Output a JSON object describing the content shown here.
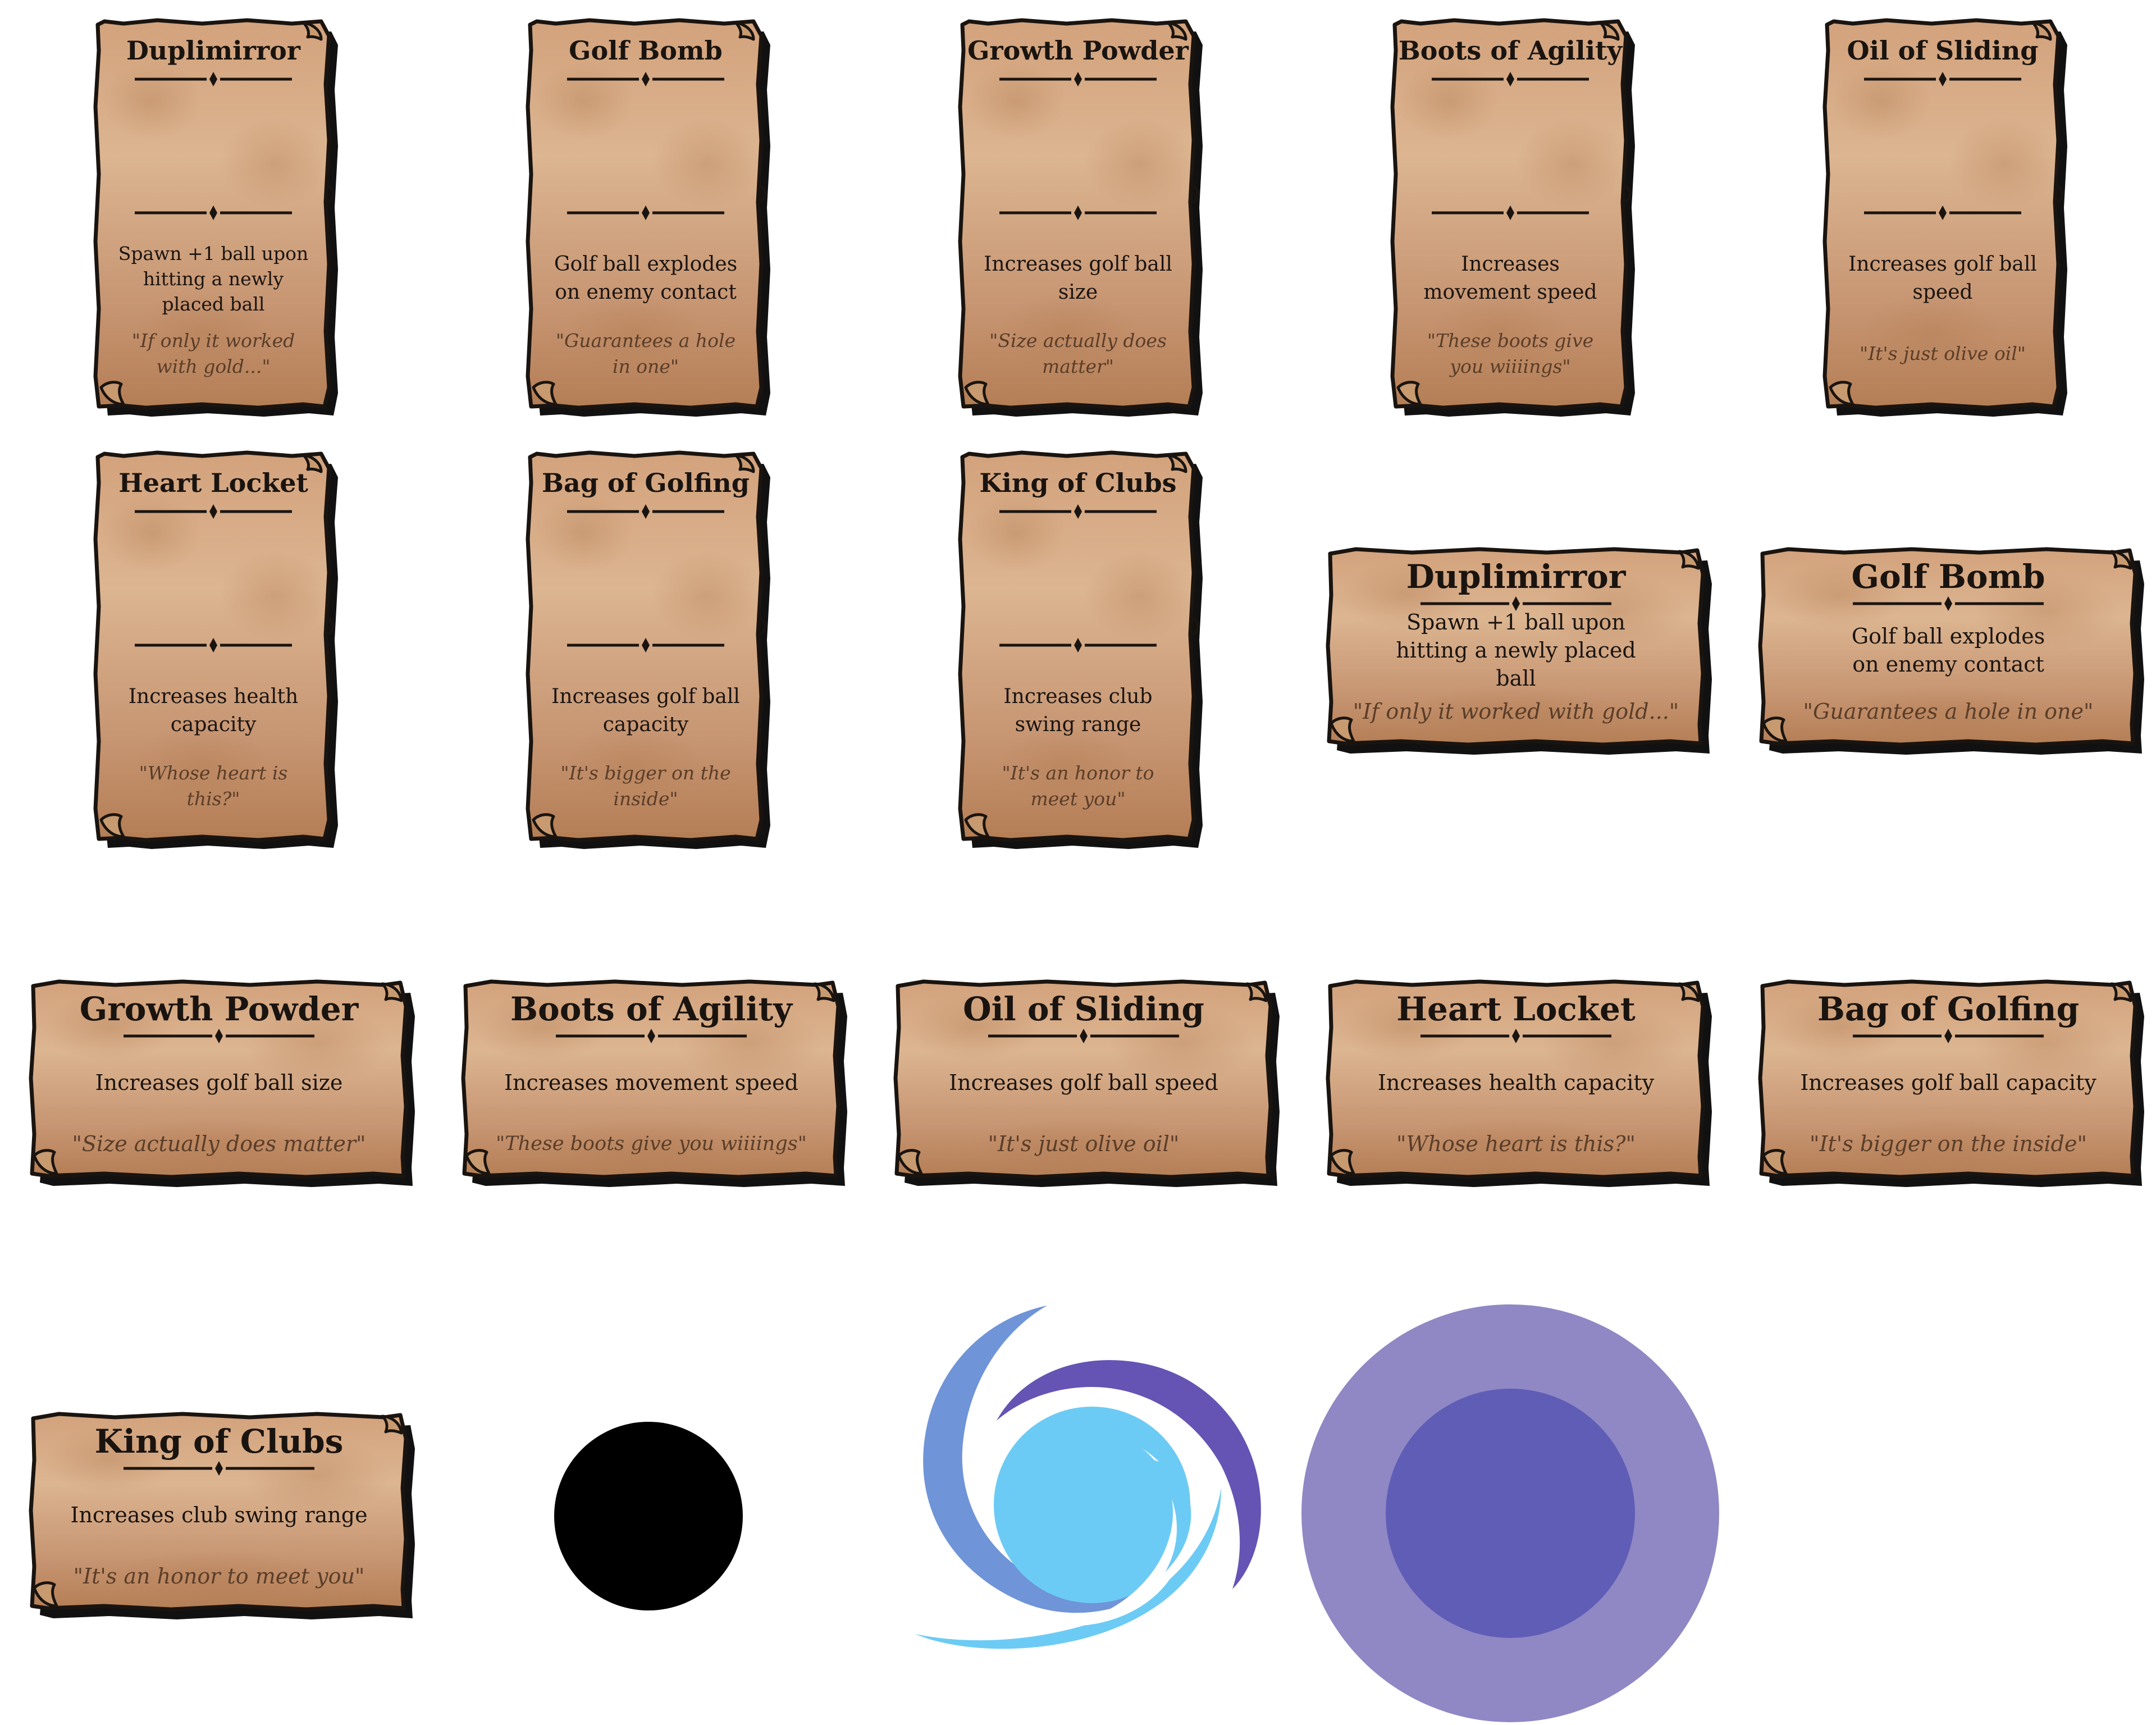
{
  "colors": {
    "parchment_light": "#dcb48f",
    "parchment_dark": "#b47e55",
    "outline": "#1a1410",
    "text": "#1a1410",
    "quote_text": "#5a3d28",
    "black_hole": "#000000",
    "swirl_light": "#6ccbf4",
    "swirl_mid": "#6f94d8",
    "swirl_dark": "#6554b4",
    "portal_outer": "#9088c4",
    "portal_inner": "#5f5db6"
  },
  "cards_portrait": [
    {
      "title": "Duplimirror",
      "desc": "Spawn +1 ball upon hitting a newly placed ball",
      "quote": "\"If only it worked with gold...\""
    },
    {
      "title": "Golf Bomb",
      "desc": "Golf ball explodes on enemy contact",
      "quote": "\"Guarantees a hole in one\""
    },
    {
      "title": "Growth Powder",
      "desc": "Increases golf ball size",
      "quote": "\"Size actually does matter\""
    },
    {
      "title": "Boots of Agility",
      "desc": "Increases movement speed",
      "quote": "\"These boots give you wiiiings\""
    },
    {
      "title": "Oil of Sliding",
      "desc": "Increases golf ball speed",
      "quote": "\"It's just olive oil\""
    },
    {
      "title": "Heart Locket",
      "desc": "Increases health capacity",
      "quote": "\"Whose heart is this?\""
    },
    {
      "title": "Bag of Golfing",
      "desc": "Increases golf ball capacity",
      "quote": "\"It's bigger on the inside\""
    },
    {
      "title": "King of Clubs",
      "desc": "Increases club swing range",
      "quote": "\"It's an honor to meet you\""
    }
  ],
  "cards_landscape": [
    {
      "title": "Duplimirror",
      "desc": "Spawn +1 ball upon hitting a newly placed ball",
      "quote": "\"If only it worked with gold...\""
    },
    {
      "title": "Golf Bomb",
      "desc": "Golf ball explodes on enemy contact",
      "quote": "\"Guarantees a hole in one\""
    },
    {
      "title": "Growth Powder",
      "desc": "Increases golf ball size",
      "quote": "\"Size actually does matter\""
    },
    {
      "title": "Boots of Agility",
      "desc": "Increases movement speed",
      "quote": "\"These boots give you wiiiings\""
    },
    {
      "title": "Oil of Sliding",
      "desc": "Increases golf ball speed",
      "quote": "\"It's just olive oil\""
    },
    {
      "title": "Heart Locket",
      "desc": "Increases health capacity",
      "quote": "\"Whose heart is this?\""
    },
    {
      "title": "Bag of Golfing",
      "desc": "Increases golf ball capacity",
      "quote": "\"It's bigger on the inside\""
    },
    {
      "title": "King of Clubs",
      "desc": "Increases club swing range",
      "quote": "\"It's an honor to meet you\""
    }
  ],
  "misc_sprites": [
    {
      "icon": "black-hole-icon"
    },
    {
      "icon": "swirl-vortex-icon"
    },
    {
      "icon": "purple-portal-icon"
    }
  ]
}
